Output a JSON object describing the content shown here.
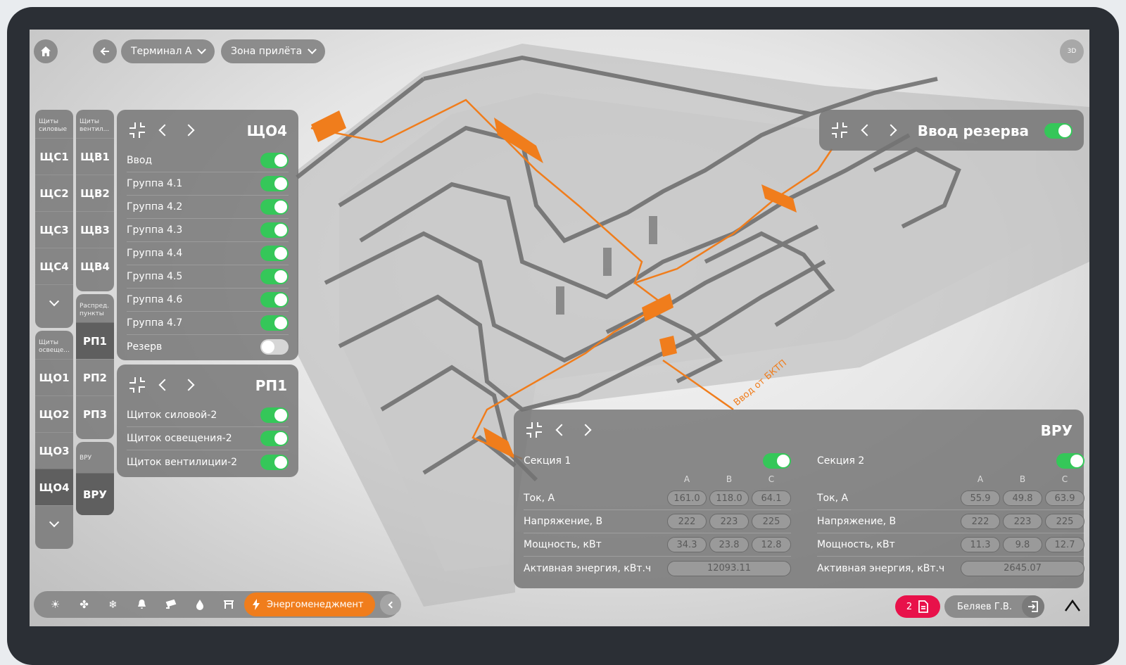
{
  "nav": {
    "terminal": "Терминал А",
    "zone": "Зона прилёта",
    "btn3d": "3D"
  },
  "col1": {
    "head1": "Щиты\nсиловые",
    "power": [
      "ЩС1",
      "ЩС2",
      "ЩС3",
      "ЩС4"
    ],
    "head2": "Щиты\nосвеще...",
    "light": [
      "ЩО1",
      "ЩО2",
      "ЩО3",
      "ЩО4"
    ],
    "active": "ЩО4"
  },
  "col2": {
    "head1": "Щиты\nвентил...",
    "vent": [
      "ЩВ1",
      "ЩВ2",
      "ЩВ3",
      "ЩВ4"
    ],
    "head2": "Распред.\nпункты",
    "rp": [
      "РП1",
      "РП2",
      "РП3"
    ],
    "head3": "ВРУ",
    "vru": "ВРУ"
  },
  "panel_sho4": {
    "title": "ЩО4",
    "rows": [
      {
        "label": "Ввод",
        "on": true
      },
      {
        "label": "Группа 4.1",
        "on": true
      },
      {
        "label": "Группа 4.2",
        "on": true
      },
      {
        "label": "Группа 4.3",
        "on": true
      },
      {
        "label": "Группа 4.4",
        "on": true
      },
      {
        "label": "Группа 4.5",
        "on": true
      },
      {
        "label": "Группа 4.6",
        "on": true
      },
      {
        "label": "Группа 4.7",
        "on": true
      },
      {
        "label": "Резерв",
        "on": false
      }
    ]
  },
  "panel_rp1": {
    "title": "РП1",
    "rows": [
      {
        "label": "Щиток силовой-2",
        "on": true
      },
      {
        "label": "Щиток освещения-2",
        "on": true
      },
      {
        "label": "Щиток вентилиции-2",
        "on": true
      }
    ]
  },
  "panel_reserve": {
    "title": "Ввод резерва",
    "on": true
  },
  "map_label": "Ввод от БКТП",
  "panel_vru": {
    "title": "ВРУ",
    "phases": [
      "A",
      "B",
      "C"
    ],
    "sections": [
      {
        "name": "Секция 1",
        "on": true,
        "current": [
          "161.0",
          "118.0",
          "64.1"
        ],
        "voltage": [
          "222",
          "223",
          "225"
        ],
        "power": [
          "34.3",
          "23.8",
          "12.8"
        ],
        "energy": "12093.11"
      },
      {
        "name": "Секция 2",
        "on": true,
        "current": [
          "55.9",
          "49.8",
          "63.9"
        ],
        "voltage": [
          "222",
          "223",
          "225"
        ],
        "power": [
          "11.3",
          "9.8",
          "12.7"
        ],
        "energy": "2645.07"
      }
    ],
    "labels": {
      "current": "Ток, А",
      "voltage": "Напряжение, В",
      "power": "Мощность, кВт",
      "energy": "Активная энергия, кВт.ч"
    }
  },
  "toolbar": {
    "icons": [
      "light-icon",
      "fan-icon",
      "snowflake-icon",
      "bell-icon",
      "camera-icon",
      "water-drop-icon",
      "gate-icon"
    ],
    "active_label": "Энергоменеджмент"
  },
  "status": {
    "reports_count": "2",
    "user_name": "Беляев Г.В."
  },
  "colors": {
    "accent": "#f07d1c",
    "toggle_on": "#35c759",
    "alert": "#e8114a"
  }
}
